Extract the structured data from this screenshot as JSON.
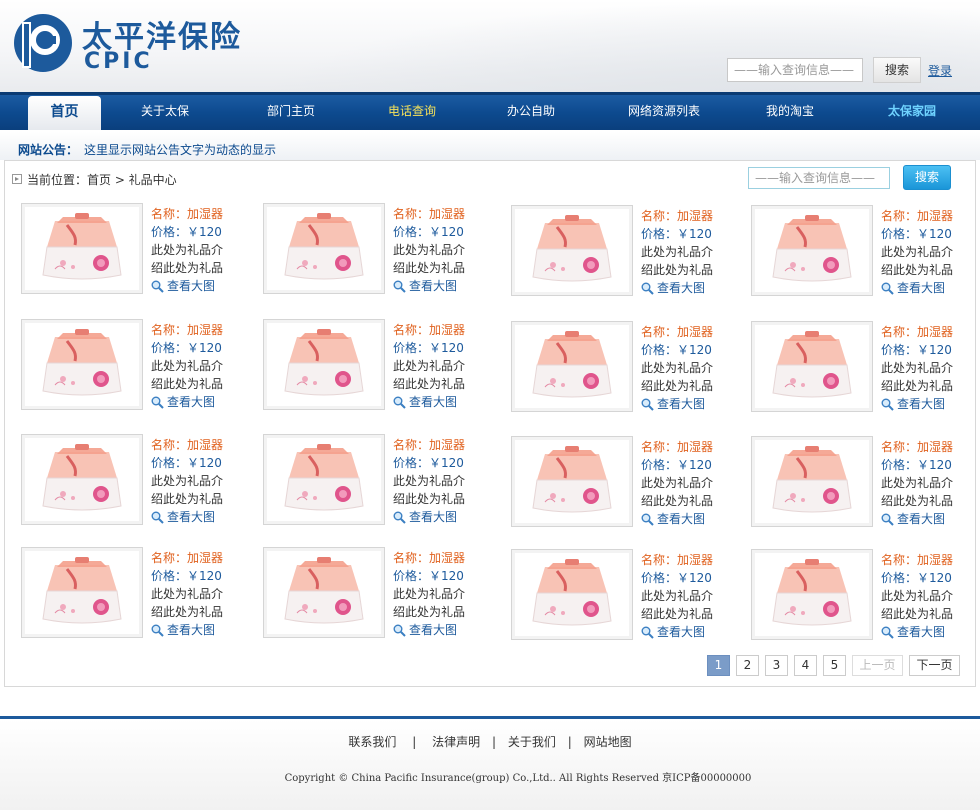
{
  "brand": {
    "name_cn": "太平洋保险",
    "name_en": "CPIC",
    "color": "#1d5a9c"
  },
  "header": {
    "search_placeholder": "——输入查询信息——",
    "search_button": "搜索",
    "login_link": "登录"
  },
  "nav": {
    "items": [
      {
        "label": "首页",
        "state": "active"
      },
      {
        "label": "关于太保",
        "state": "normal"
      },
      {
        "label": "部门主页",
        "state": "normal"
      },
      {
        "label": "电话查询",
        "state": "highlight-yellow"
      },
      {
        "label": "办公自助",
        "state": "normal"
      },
      {
        "label": "网络资源列表",
        "state": "normal"
      },
      {
        "label": "我的淘宝",
        "state": "normal"
      },
      {
        "label": "太保家园",
        "state": "highlight-cyan"
      }
    ]
  },
  "notice": {
    "label": "网站公告：",
    "text": "这里显示网站公告文字为动态的显示"
  },
  "breadcrumb": {
    "text": "当前位置：首页 > 礼品中心"
  },
  "main": {
    "search_placeholder": "——输入查询信息——",
    "search_button": "搜索"
  },
  "product": {
    "name": "名称：加湿器",
    "price": "价格：￥120",
    "desc_line1": "此处为礼品介",
    "desc_line2": "绍此处为礼品",
    "view": "查看大图",
    "image_icon": "humidifier-image"
  },
  "products": [
    {
      "name": "名称：加湿器",
      "price": "价格：￥120",
      "desc1": "此处为礼品介",
      "desc2": "绍此处为礼品",
      "view": "查看大图"
    },
    {
      "name": "名称：加湿器",
      "price": "价格：￥120",
      "desc1": "此处为礼品介",
      "desc2": "绍此处为礼品",
      "view": "查看大图"
    },
    {
      "name": "名称：加湿器",
      "price": "价格：￥120",
      "desc1": "此处为礼品介",
      "desc2": "绍此处为礼品",
      "view": "查看大图"
    },
    {
      "name": "名称：加湿器",
      "price": "价格：￥120",
      "desc1": "此处为礼品介",
      "desc2": "绍此处为礼品",
      "view": "查看大图"
    },
    {
      "name": "名称：加湿器",
      "price": "价格：￥120",
      "desc1": "此处为礼品介",
      "desc2": "绍此处为礼品",
      "view": "查看大图"
    },
    {
      "name": "名称：加湿器",
      "price": "价格：￥120",
      "desc1": "此处为礼品介",
      "desc2": "绍此处为礼品",
      "view": "查看大图"
    },
    {
      "name": "名称：加湿器",
      "price": "价格：￥120",
      "desc1": "此处为礼品介",
      "desc2": "绍此处为礼品",
      "view": "查看大图"
    },
    {
      "name": "名称：加湿器",
      "price": "价格：￥120",
      "desc1": "此处为礼品介",
      "desc2": "绍此处为礼品",
      "view": "查看大图"
    },
    {
      "name": "名称：加湿器",
      "price": "价格：￥120",
      "desc1": "此处为礼品介",
      "desc2": "绍此处为礼品",
      "view": "查看大图"
    },
    {
      "name": "名称：加湿器",
      "price": "价格：￥120",
      "desc1": "此处为礼品介",
      "desc2": "绍此处为礼品",
      "view": "查看大图"
    },
    {
      "name": "名称：加湿器",
      "price": "价格：￥120",
      "desc1": "此处为礼品介",
      "desc2": "绍此处为礼品",
      "view": "查看大图"
    },
    {
      "name": "名称：加湿器",
      "price": "价格：￥120",
      "desc1": "此处为礼品介",
      "desc2": "绍此处为礼品",
      "view": "查看大图"
    },
    {
      "name": "名称：加湿器",
      "price": "价格：￥120",
      "desc1": "此处为礼品介",
      "desc2": "绍此处为礼品",
      "view": "查看大图"
    },
    {
      "name": "名称：加湿器",
      "price": "价格：￥120",
      "desc1": "此处为礼品介",
      "desc2": "绍此处为礼品",
      "view": "查看大图"
    },
    {
      "name": "名称：加湿器",
      "price": "价格：￥120",
      "desc1": "此处为礼品介",
      "desc2": "绍此处为礼品",
      "view": "查看大图"
    },
    {
      "name": "名称：加湿器",
      "price": "价格：￥120",
      "desc1": "此处为礼品介",
      "desc2": "绍此处为礼品",
      "view": "查看大图"
    }
  ],
  "pagination": {
    "pages": [
      "1",
      "2",
      "3",
      "4",
      "5"
    ],
    "current": "1",
    "prev": "上一页",
    "next": "下一页"
  },
  "footer": {
    "links": [
      "联系我们",
      "法律声明",
      "关于我们",
      "网站地图"
    ],
    "separators": [
      "|",
      "|",
      "|"
    ],
    "copyright": "Copyright © China Pacific Insurance(group) Co.,Ltd.. All Rights Reserved 京ICP备00000000"
  }
}
